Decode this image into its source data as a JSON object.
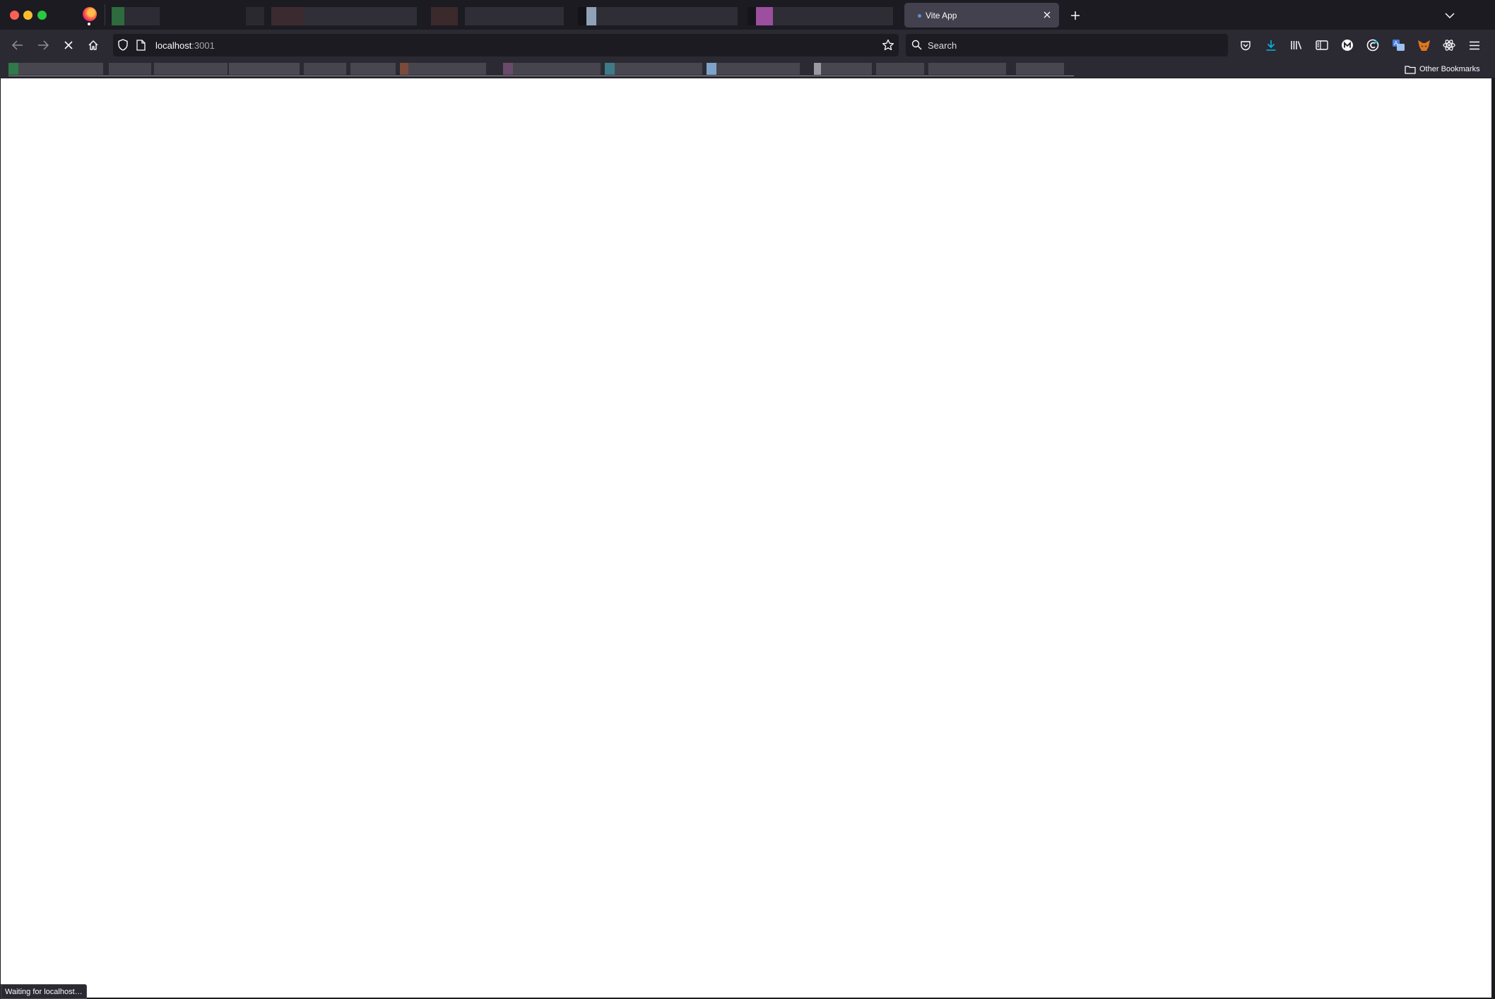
{
  "browser": {
    "window_controls": [
      "close",
      "minimize",
      "maximize"
    ],
    "active_tab": {
      "title": "Vite App",
      "icon": "loading-dot-icon"
    },
    "new_tab_icon": "plus-icon",
    "list_all_tabs_icon": "chevron-down-icon",
    "background_tabs_note": "blurred"
  },
  "navbar": {
    "url_host": "localhost",
    "url_port": ":3001",
    "search_placeholder": "Search",
    "icons": [
      "back-icon",
      "forward-icon",
      "stop-icon",
      "home-icon",
      "shield-icon",
      "page-icon",
      "bookmark-star-icon",
      "pocket-icon",
      "downloads-icon",
      "library-icon",
      "sidebar-icon",
      "extension-m-icon",
      "extension-c-icon",
      "translate-icon",
      "metamask-icon",
      "react-devtools-icon",
      "menu-icon"
    ]
  },
  "bookmarks": {
    "other_bookmarks_label": "Other Bookmarks",
    "folder_icon": "folder-icon"
  },
  "status_bar": {
    "text": "Waiting for localhost…"
  },
  "colors": {
    "tabbar_bg": "#1c1b22",
    "toolbar_bg": "#2b2a33",
    "active_tab_bg": "#42414d",
    "accent_download": "#00b8e6",
    "content_bg": "#ffffff"
  }
}
